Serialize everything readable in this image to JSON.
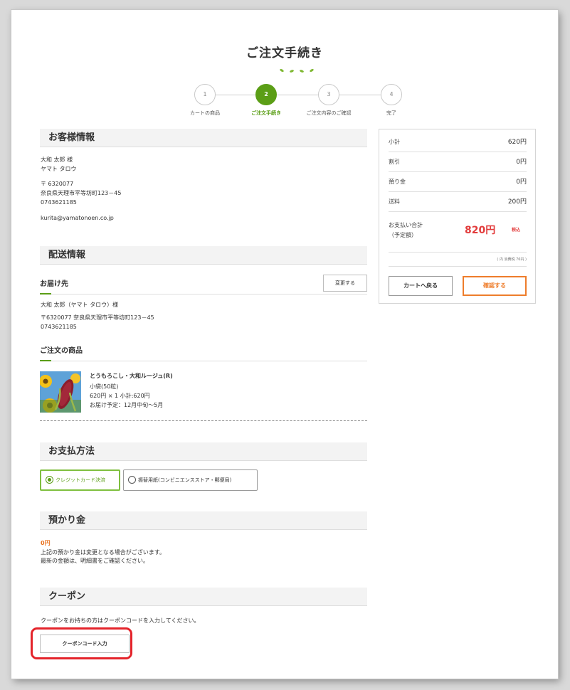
{
  "page": {
    "title": "ご注文手続き"
  },
  "stepper": {
    "steps": [
      {
        "number": "1",
        "label": "カートの商品"
      },
      {
        "number": "2",
        "label": "ご注文手続き"
      },
      {
        "number": "3",
        "label": "ご注文内容のご確認"
      },
      {
        "number": "4",
        "label": "完了"
      }
    ],
    "active_step": 2
  },
  "customer": {
    "heading": "お客様情報",
    "name": "大和 太郎 様",
    "kana": "ヤマト タロウ",
    "postal": "〒 6320077",
    "address": "奈良県天理市平等坊町123－45",
    "phone": "0743621185",
    "email": "kurita@yamatonoen.co.jp"
  },
  "shipping": {
    "heading": "配送情報",
    "dest_heading": "お届け先",
    "change_button": "変更する",
    "name": "大和 太郎（ヤマト タロウ）様",
    "address": "〒6320077 奈良県天理市平等坊町123－45",
    "phone": "0743621185"
  },
  "order_items": {
    "heading": "ご注文の商品",
    "items": [
      {
        "name": "とうもろこし・大和ルージュ(R)",
        "variant": "小袋(50粒)",
        "qty_price": "620円 × 1  小計:620円",
        "delivery": "お届け予定：12月中旬～5月"
      }
    ]
  },
  "payment": {
    "heading": "お支払方法",
    "options": [
      {
        "label": "クレジットカード決済",
        "selected": true
      },
      {
        "label": "振替用紙(コンビニエンスストア・郵便局)",
        "selected": false
      }
    ]
  },
  "deposit": {
    "heading": "預かり金",
    "amount": "0円",
    "note1": "上記の預かり金は変更となる場合がございます。",
    "note2": "最新の金額は、明細書をご確認ください。"
  },
  "coupon": {
    "heading": "クーポン",
    "note": "クーポンをお持ちの方はクーポンコードを入力してください。",
    "button": "クーポンコード入力"
  },
  "summary": {
    "rows": [
      {
        "label": "小計",
        "value": "620円"
      },
      {
        "label": "割引",
        "value": "0円"
      },
      {
        "label": "預り金",
        "value": "0円"
      },
      {
        "label": "送料",
        "value": "200円"
      }
    ],
    "total_label_1": "お支払い合計",
    "total_label_2": "（予定額）",
    "total_value": "820円",
    "tax_included": "税込",
    "tax_note": "( 内 消費税 76円 )",
    "back_button": "カートへ戻る",
    "confirm_button": "確認する"
  },
  "colors": {
    "accent_green": "#5b9e16",
    "accent_orange": "#ee7d2b",
    "total_red": "#e23b3b",
    "highlight_red": "#e4242b"
  }
}
